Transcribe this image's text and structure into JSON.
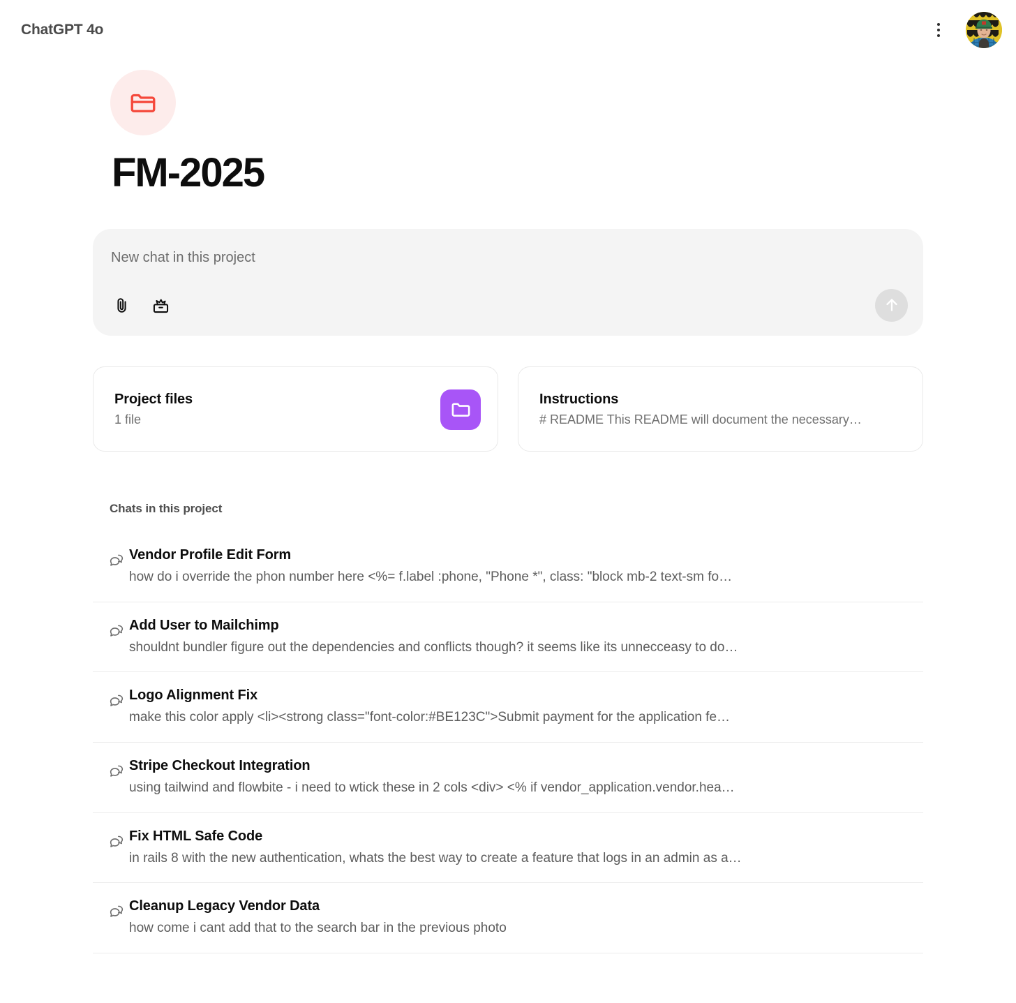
{
  "header": {
    "title": "ChatGPT 4o",
    "menu_icon": "kebab-menu-icon",
    "avatar_icon": "user-avatar"
  },
  "project": {
    "icon": "folder-icon",
    "icon_color": "#F5483B",
    "icon_bg": "#FDECEB",
    "title": "FM-2025"
  },
  "composer": {
    "placeholder": "New chat in this project",
    "attach_icon": "paperclip-icon",
    "tools_icon": "toolbox-icon",
    "send_icon": "arrow-up-icon"
  },
  "cards": [
    {
      "title": "Project files",
      "subtitle": "1 file",
      "badge_icon": "folder-icon",
      "badge_color": "#A855F7",
      "has_badge": true
    },
    {
      "title": "Instructions",
      "subtitle": "# README This README will document the necessary…",
      "has_badge": false
    }
  ],
  "chats_section": {
    "heading": "Chats in this project",
    "row_icon": "chat-bubbles-icon",
    "items": [
      {
        "title": "Vendor Profile Edit Form",
        "snippet": "how do i override the phon number here <%= f.label :phone, \"Phone *\", class: \"block mb-2 text-sm fo…"
      },
      {
        "title": "Add User to Mailchimp",
        "snippet": "shouldnt bundler figure out the dependencies and conflicts though? it seems like its unnecceasy to do…"
      },
      {
        "title": "Logo Alignment Fix",
        "snippet": "make this color apply <li><strong class=\"font-color:#BE123C\">Submit payment for the application fe…"
      },
      {
        "title": "Stripe Checkout Integration",
        "snippet": "using tailwind and flowbite - i need to wtick these in 2 cols <div> <% if vendor_application.vendor.hea…"
      },
      {
        "title": "Fix HTML Safe Code",
        "snippet": "in rails 8 with the new authentication, whats the best way to create a feature that logs in an admin as a…"
      },
      {
        "title": "Cleanup Legacy Vendor Data",
        "snippet": "how come i cant add that to the search bar in the previous photo"
      }
    ]
  }
}
